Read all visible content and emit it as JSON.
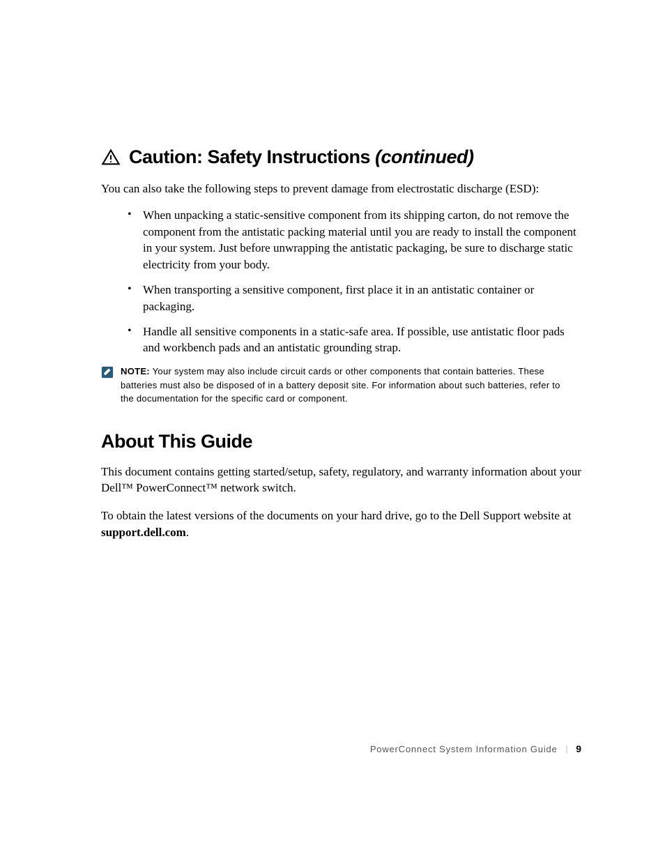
{
  "caution": {
    "title": "Caution: Safety Instructions ",
    "continued": "(continued)",
    "intro": "You can also take the following steps to prevent damage from electrostatic discharge (ESD):",
    "bullets": [
      "When unpacking a static-sensitive component from its shipping carton, do not remove the component from the antistatic packing material until you are ready to install the component in your system. Just before unwrapping the antistatic packaging, be sure to discharge static electricity from your body.",
      "When transporting a sensitive component, first place it in an antistatic container or packaging.",
      "Handle all sensitive components in a static-safe area. If possible, use antistatic floor pads and workbench pads and an antistatic grounding strap."
    ]
  },
  "note": {
    "label": "NOTE:",
    "text": " Your system may also include circuit cards or other components that contain batteries. These batteries must also be disposed of in a battery deposit site. For information about such batteries, refer to the documentation for the specific card or component."
  },
  "about": {
    "heading": "About This Guide",
    "para1": "This document contains getting started/setup, safety, regulatory, and warranty information about your Dell™ PowerConnect™ network switch.",
    "para2_prefix": "To obtain the latest versions of the documents on your hard drive, go to the Dell Support website at ",
    "para2_bold": "support.dell.com",
    "para2_suffix": "."
  },
  "footer": {
    "text": "PowerConnect System Information Guide",
    "page": "9"
  }
}
